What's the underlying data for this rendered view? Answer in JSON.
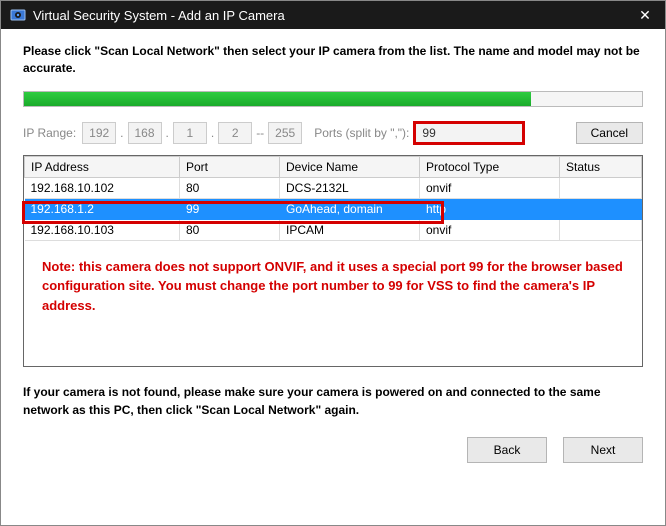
{
  "window": {
    "title": "Virtual Security System - Add an IP Camera"
  },
  "intro": "Please click \"Scan Local Network\" then select your IP camera from the list. The name and model may not be accurate.",
  "iprange": {
    "label": "IP Range:",
    "o1": "192",
    "o2": "168",
    "o3": "1",
    "o4a": "2",
    "o4b": "255",
    "dash": "--",
    "ports_label": "Ports (split by \",\"):",
    "ports_value": "99"
  },
  "buttons": {
    "cancel": "Cancel",
    "back": "Back",
    "next": "Next"
  },
  "table": {
    "headers": {
      "ip": "IP Address",
      "port": "Port",
      "device": "Device Name",
      "proto": "Protocol Type",
      "status": "Status"
    },
    "rows": [
      {
        "ip": "192.168.10.102",
        "port": "80",
        "device": "DCS-2132L",
        "proto": "onvif",
        "status": ""
      },
      {
        "ip": "192.168.1.2",
        "port": "99",
        "device": "GoAhead, domain",
        "proto": "http",
        "status": ""
      },
      {
        "ip": "192.168.10.103",
        "port": "80",
        "device": "IPCAM",
        "proto": "onvif",
        "status": ""
      }
    ]
  },
  "note": "Note: this camera does not support ONVIF, and it uses a special port 99 for the browser based configuration site. You must change the port number to 99 for VSS to find the camera's IP address.",
  "outro": "If your camera is not found, please make sure your camera is powered on and connected to the same network as this PC, then click \"Scan Local Network\" again."
}
